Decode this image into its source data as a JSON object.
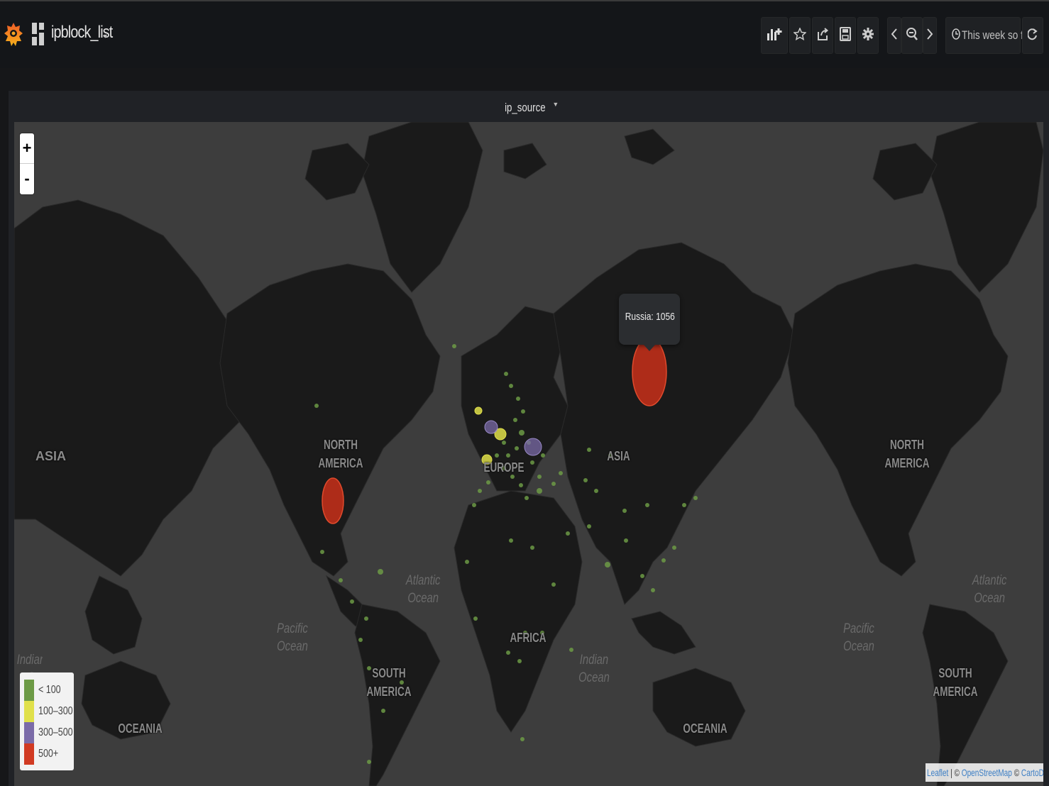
{
  "dashboard": {
    "title": "ipblock_list",
    "time_range": "This week so far"
  },
  "toolbar": {
    "icons": [
      "add-panel-icon",
      "star-icon",
      "share-icon",
      "save-icon",
      "gear-icon",
      "chevron-left-icon",
      "zoom-out-icon",
      "chevron-right-icon",
      "clock-icon",
      "refresh-icon"
    ]
  },
  "panel": {
    "title": "ip_source"
  },
  "map": {
    "zoom_in": "+",
    "zoom_out": "-",
    "tooltip": "Russia: 1056",
    "continent_labels": [
      {
        "id": "asia-left",
        "text": "ASIA"
      },
      {
        "id": "north-america",
        "text": "NORTH AMERICA"
      },
      {
        "id": "europe",
        "text": "EUROPE"
      },
      {
        "id": "asia",
        "text": "ASIA"
      },
      {
        "id": "north-america-right",
        "text": "NORTH AMERICA"
      },
      {
        "id": "africa",
        "text": "AFRICA"
      },
      {
        "id": "south-america",
        "text": "SOUTH AMERICA"
      },
      {
        "id": "south-america-right",
        "text": "SOUTH AMERICA"
      },
      {
        "id": "oceania-left",
        "text": "OCEANIA"
      },
      {
        "id": "oceania-right",
        "text": "OCEANIA"
      }
    ],
    "ocean_labels": [
      {
        "id": "atlantic",
        "text": "Atlantic Ocean"
      },
      {
        "id": "atlantic-right",
        "text": "Atlantic Ocean"
      },
      {
        "id": "pacific",
        "text": "Pacific Ocean"
      },
      {
        "id": "pacific-right",
        "text": "Pacific Ocean"
      },
      {
        "id": "indian",
        "text": "Indian Ocean"
      },
      {
        "id": "indian-left",
        "text": "Indian O"
      }
    ],
    "legend": [
      {
        "label": "< 100",
        "color": "#6c9a45"
      },
      {
        "label": "100–300",
        "color": "#e0e04a"
      },
      {
        "label": "300–500",
        "color": "#7b6ba8"
      },
      {
        "label": "500+",
        "color": "#d13a22"
      }
    ],
    "attribution": {
      "leaflet": "Leaflet",
      "sep1": " | © ",
      "osm": "OpenStreetMap",
      "sep2": " © ",
      "carto": "CartoDB"
    }
  }
}
